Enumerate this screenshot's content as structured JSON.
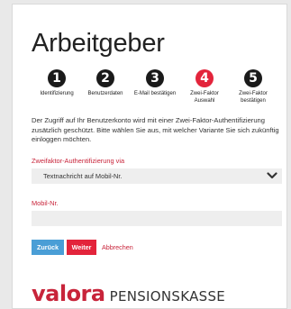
{
  "page": {
    "title": "Arbeitgeber"
  },
  "steps": [
    {
      "number": "1",
      "label": "Identifizierung",
      "active": false
    },
    {
      "number": "2",
      "label": "Benutzerdaten",
      "active": false
    },
    {
      "number": "3",
      "label": "E-Mail bestätigen",
      "active": false
    },
    {
      "number": "4",
      "label": "Zwei-Faktor Auswahl",
      "active": true
    },
    {
      "number": "5",
      "label": "Zwei-Faktor bestätigen",
      "active": false
    }
  ],
  "description": "Der Zugriff auf Ihr Benutzerkonto wird mit einer Zwei-Faktor-Authentifizierung zusätzlich geschützt. Bitte wählen Sie aus, mit welcher Variante Sie sich zukünftig einloggen möchten.",
  "form": {
    "method_label": "Zweifaktor-Authentifizierung via",
    "method_value": "Textnachricht auf Mobil-Nr.",
    "phone_label": "Mobil-Nr.",
    "phone_value": "",
    "phone_placeholder": ""
  },
  "buttons": {
    "back": "Zurück",
    "next": "Weiter",
    "cancel": "Abbrechen"
  },
  "brand": {
    "logo": "valora",
    "subtitle": "PENSIONSKASSE"
  },
  "colors": {
    "accent_red": "#e3243b",
    "brand_red": "#c8243a",
    "back_blue": "#4a9ed6",
    "step_dark": "#1a1a1a"
  }
}
